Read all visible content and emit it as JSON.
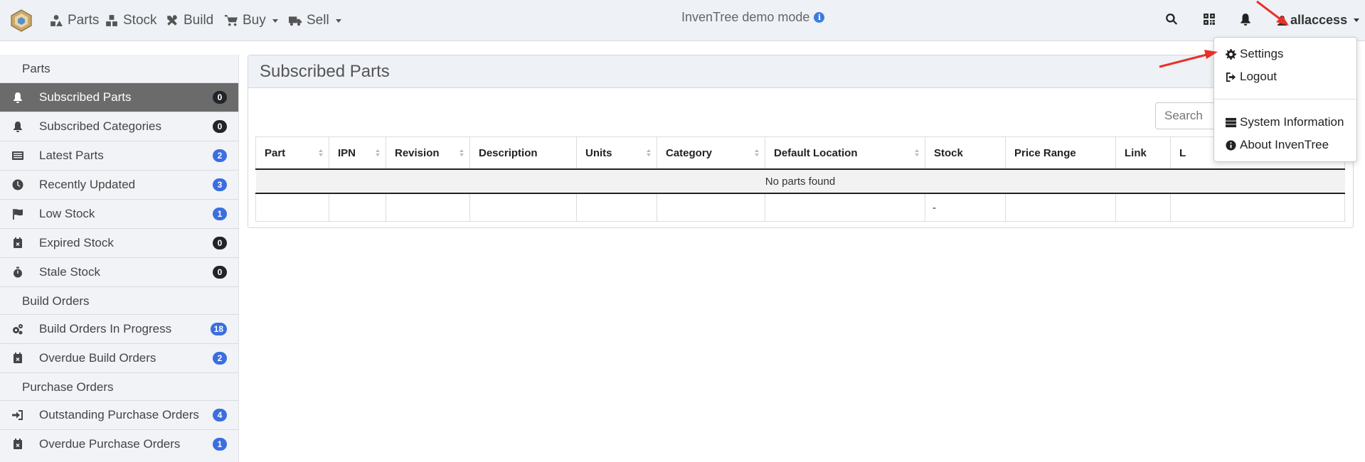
{
  "navbar": {
    "brand": "InvenTree",
    "links": [
      {
        "label": "Parts",
        "icon": "shapes-icon"
      },
      {
        "label": "Stock",
        "icon": "boxes-icon"
      },
      {
        "label": "Build",
        "icon": "tools-icon"
      },
      {
        "label": "Buy",
        "icon": "shopping-cart-icon",
        "dropdown": true
      },
      {
        "label": "Sell",
        "icon": "truck-icon",
        "dropdown": true
      }
    ],
    "demo_text": "InvenTree demo mode",
    "info_glyph": "i",
    "user": "allaccess"
  },
  "sidebar": {
    "sections": [
      {
        "header": "Parts",
        "items": [
          {
            "label": "Subscribed Parts",
            "badge": "0",
            "active": true
          },
          {
            "label": "Subscribed Categories",
            "badge": "0"
          },
          {
            "label": "Latest Parts",
            "badge": "2"
          },
          {
            "label": "Recently Updated",
            "badge": "3"
          },
          {
            "label": "Low Stock",
            "badge": "1"
          },
          {
            "label": "Expired Stock",
            "badge": "0"
          },
          {
            "label": "Stale Stock",
            "badge": "0"
          }
        ]
      },
      {
        "header": "Build Orders",
        "items": [
          {
            "label": "Build Orders In Progress",
            "badge": "18"
          },
          {
            "label": "Overdue Build Orders",
            "badge": "2"
          }
        ]
      },
      {
        "header": "Purchase Orders",
        "items": [
          {
            "label": "Outstanding Purchase Orders",
            "badge": "4"
          },
          {
            "label": "Overdue Purchase Orders",
            "badge": "1"
          }
        ]
      }
    ]
  },
  "main": {
    "title": "Subscribed Parts",
    "search_placeholder": "Search",
    "table": {
      "columns": [
        "Part",
        "IPN",
        "Revision",
        "Description",
        "Units",
        "Category",
        "Default Location",
        "Stock",
        "Price Range",
        "Link",
        "L"
      ],
      "empty_message": "No parts found",
      "footer_stock": "-"
    }
  },
  "user_menu": {
    "items": [
      {
        "label": "Settings",
        "icon": "gear-icon"
      },
      {
        "label": "Logout",
        "icon": "sign-out-icon"
      },
      {
        "label": "System Information",
        "icon": "server-icon"
      },
      {
        "label": "About InvenTree",
        "icon": "info-circle-icon"
      }
    ]
  },
  "colors": {
    "navbar_bg": "#eef1f5",
    "active_item_bg": "#6b6b6b",
    "badge_blue": "#3b6ee0",
    "badge_dark": "#212529",
    "annotation_arrow": "#e8302a"
  }
}
